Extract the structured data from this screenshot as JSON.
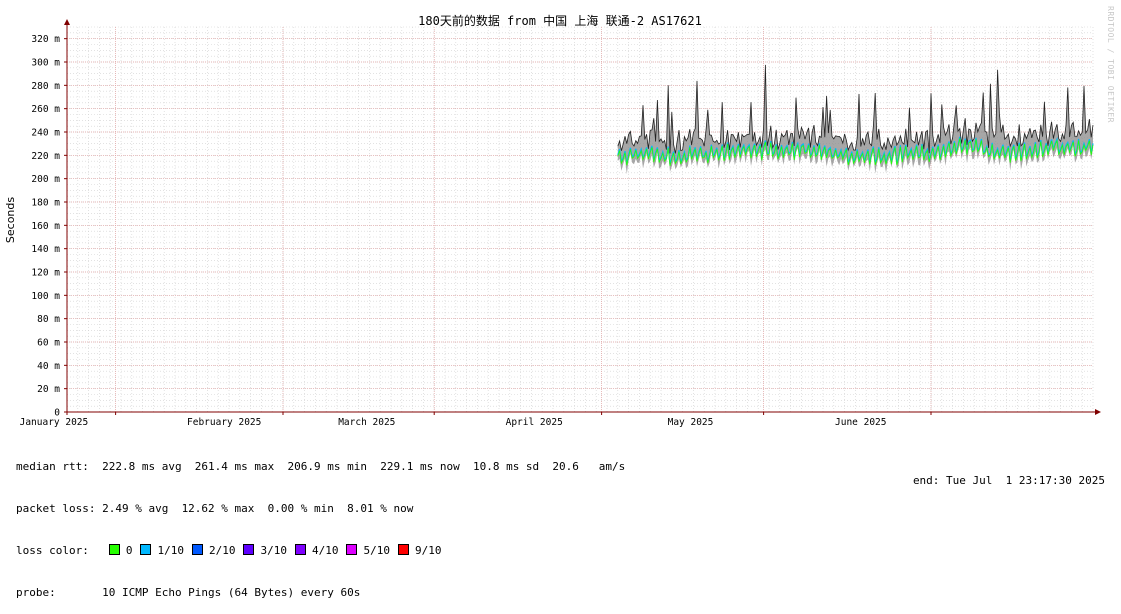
{
  "chart_data": {
    "type": "area",
    "title": "180天前的数据 from 中国 上海 联通-2 AS17621",
    "ylabel": "Seconds",
    "ylim": [
      0,
      0.33
    ],
    "y_tick_labels": [
      "0",
      "20 m",
      "40 m",
      "60 m",
      "80 m",
      "100 m",
      "120 m",
      "140 m",
      "160 m",
      "180 m",
      "200 m",
      "220 m",
      "240 m",
      "260 m",
      "280 m",
      "300 m",
      "320 m"
    ],
    "y_tick_values": [
      0,
      0.02,
      0.04,
      0.06,
      0.08,
      0.1,
      0.12,
      0.14,
      0.16,
      0.18,
      0.2,
      0.22,
      0.24,
      0.26,
      0.28,
      0.3,
      0.32
    ],
    "x_tick_labels": [
      "January 2025",
      "February 2025",
      "March 2025",
      "April 2025",
      "May 2025",
      "June 2025"
    ],
    "x_range": [
      "2024-12-23",
      "2025-07-01"
    ],
    "x_month_starts": [
      "2025-01-01",
      "2025-02-01",
      "2025-03-01",
      "2025-04-01",
      "2025-05-01",
      "2025-06-01"
    ],
    "data_start": "2025-04-04",
    "series": [
      {
        "name": "median rtt",
        "x": [
          "2025-04-04",
          "2025-04-09",
          "2025-04-14",
          "2025-04-19",
          "2025-04-24",
          "2025-04-29",
          "2025-05-04",
          "2025-05-09",
          "2025-05-14",
          "2025-05-19",
          "2025-05-24",
          "2025-05-29",
          "2025-06-03",
          "2025-06-08",
          "2025-06-13",
          "2025-06-18",
          "2025-06-23",
          "2025-06-28",
          "2025-07-01"
        ],
        "values": [
          0.22,
          0.222,
          0.22,
          0.221,
          0.223,
          0.225,
          0.224,
          0.226,
          0.222,
          0.219,
          0.22,
          0.222,
          0.224,
          0.23,
          0.222,
          0.224,
          0.228,
          0.226,
          0.229
        ]
      }
    ],
    "grid": true
  },
  "legend": {
    "median_rtt": "median rtt:  222.8 ms avg  261.4 ms max  206.9 ms min  229.1 ms now  10.8 ms sd  20.6   am/s",
    "packet_loss": "packet loss: 2.49 % avg  12.62 % max  0.00 % min  8.01 % now",
    "loss_color_label": "loss color:",
    "loss_colors": [
      {
        "label": "0",
        "color": "#26ff00"
      },
      {
        "label": "1/10",
        "color": "#00b8ff"
      },
      {
        "label": "2/10",
        "color": "#0059ff"
      },
      {
        "label": "3/10",
        "color": "#5e00ff"
      },
      {
        "label": "4/10",
        "color": "#7e00ff"
      },
      {
        "label": "5/10",
        "color": "#dd00ff"
      },
      {
        "label": "9/10",
        "color": "#ff0000"
      }
    ],
    "probe": "probe:       10 ICMP Echo Pings (64 Bytes) every 60s",
    "end": "end: Tue Jul  1 23:17:30 2025"
  },
  "watermark": "RRDTOOL / TOBI OETIKER",
  "colors": {
    "major_grid": "#e0a0a0",
    "minor_grid": "#d0d0d0",
    "axis": "#800000",
    "smoke": "#8a8a8a"
  }
}
